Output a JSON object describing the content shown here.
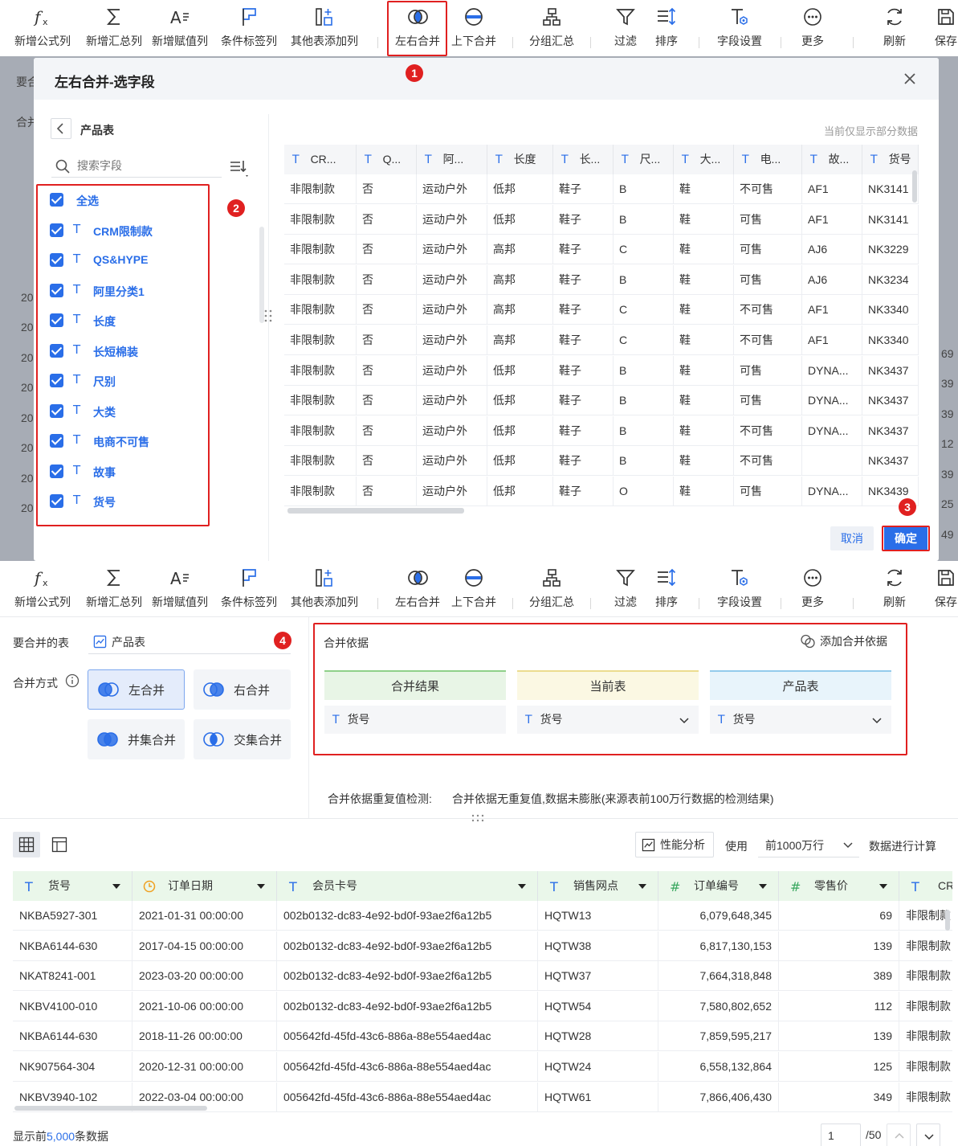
{
  "toolbar": {
    "items": [
      {
        "label": "新增公式列",
        "icon": "fx-icon"
      },
      {
        "label": "新增汇总列",
        "icon": "sigma-icon"
      },
      {
        "label": "新增赋值列",
        "icon": "assign-icon"
      },
      {
        "label": "条件标签列",
        "icon": "flag-icon"
      },
      {
        "label": "其他表添加列",
        "icon": "add-column-icon"
      },
      {
        "label": "左右合并",
        "icon": "left-right-merge-icon"
      },
      {
        "label": "上下合并",
        "icon": "top-bottom-merge-icon"
      },
      {
        "label": "分组汇总",
        "icon": "group-icon"
      },
      {
        "label": "过滤",
        "icon": "filter-icon"
      },
      {
        "label": "排序",
        "icon": "sort-icon"
      },
      {
        "label": "字段设置",
        "icon": "field-settings-icon"
      },
      {
        "label": "更多",
        "icon": "more-icon"
      },
      {
        "label": "刷新",
        "icon": "refresh-icon"
      },
      {
        "label": "保存",
        "icon": "save-icon"
      }
    ]
  },
  "background_fragments": {
    "row1": "要合",
    "row2": "合并",
    "left_values": [
      "20",
      "20",
      "20",
      "20",
      "20",
      "20",
      "20",
      "20"
    ],
    "right_values": [
      "69",
      "39",
      "39",
      "12",
      "39",
      "25",
      "49"
    ]
  },
  "modal": {
    "title": "左右合并-选字段",
    "back_label": "产品表",
    "search_placeholder": "搜索字段",
    "preview_note": "当前仅显示部分数据",
    "select_all": "全选",
    "fields": [
      "CRM限制款",
      "QS&HYPE",
      "阿里分类1",
      "长度",
      "长短棉装",
      "尺别",
      "大类",
      "电商不可售",
      "故事",
      "货号"
    ],
    "type_glyph": "T",
    "columns": [
      "CR...",
      "Q...",
      "阿...",
      "长度",
      "长...",
      "尺...",
      "大...",
      "电...",
      "故...",
      "货号"
    ],
    "rows": [
      [
        "非限制款",
        "否",
        "运动户外",
        "低邦",
        "鞋子",
        "B",
        "鞋",
        "不可售",
        "AF1",
        "NK3141"
      ],
      [
        "非限制款",
        "否",
        "运动户外",
        "低邦",
        "鞋子",
        "B",
        "鞋",
        "可售",
        "AF1",
        "NK3141"
      ],
      [
        "非限制款",
        "否",
        "运动户外",
        "高邦",
        "鞋子",
        "C",
        "鞋",
        "可售",
        "AJ6",
        "NK3229"
      ],
      [
        "非限制款",
        "否",
        "运动户外",
        "高邦",
        "鞋子",
        "B",
        "鞋",
        "可售",
        "AJ6",
        "NK3234"
      ],
      [
        "非限制款",
        "否",
        "运动户外",
        "高邦",
        "鞋子",
        "C",
        "鞋",
        "不可售",
        "AF1",
        "NK3340"
      ],
      [
        "非限制款",
        "否",
        "运动户外",
        "高邦",
        "鞋子",
        "C",
        "鞋",
        "不可售",
        "AF1",
        "NK3340"
      ],
      [
        "非限制款",
        "否",
        "运动户外",
        "低邦",
        "鞋子",
        "B",
        "鞋",
        "可售",
        "DYNA...",
        "NK3437"
      ],
      [
        "非限制款",
        "否",
        "运动户外",
        "低邦",
        "鞋子",
        "B",
        "鞋",
        "可售",
        "DYNA...",
        "NK3437"
      ],
      [
        "非限制款",
        "否",
        "运动户外",
        "低邦",
        "鞋子",
        "B",
        "鞋",
        "不可售",
        "DYNA...",
        "NK3437"
      ],
      [
        "非限制款",
        "否",
        "运动户外",
        "低邦",
        "鞋子",
        "B",
        "鞋",
        "不可售",
        "",
        "NK3437"
      ],
      [
        "非限制款",
        "否",
        "运动户外",
        "低邦",
        "鞋子",
        "O",
        "鞋",
        "可售",
        "DYNA...",
        "NK3439"
      ]
    ],
    "cancel_label": "取消",
    "confirm_label": "确定"
  },
  "badges": [
    "1",
    "2",
    "3",
    "4"
  ],
  "merge_config": {
    "table_label": "要合并的表",
    "table_value": "产品表",
    "method_label": "合并方式",
    "methods": [
      "左合并",
      "右合并",
      "并集合并",
      "交集合并"
    ],
    "basis_title": "合并依据",
    "add_basis": "添加合并依据",
    "basis_columns": [
      {
        "title": "合并结果",
        "field": "货号",
        "color": "#e8f5e6",
        "border": "#8fd08a"
      },
      {
        "title": "当前表",
        "field": "货号",
        "color": "#fbf8e3",
        "border": "#ecdc8f"
      },
      {
        "title": "产品表",
        "field": "货号",
        "color": "#e8f4fb",
        "border": "#94cbec"
      }
    ],
    "dup_check_label": "合并依据重复值检测:",
    "dup_check_result": "合并依据无重复值,数据未膨胀(来源表前100万行数据的检测结果)"
  },
  "result_table": {
    "perf_label": "性能分析",
    "use_label": "使用",
    "rows_option": "前1000万行",
    "calc_label": "数据进行计算",
    "columns": [
      {
        "name": "货号",
        "type": "text"
      },
      {
        "name": "订单日期",
        "type": "date"
      },
      {
        "name": "会员卡号",
        "type": "text"
      },
      {
        "name": "销售网点",
        "type": "text"
      },
      {
        "name": "订单编号",
        "type": "number"
      },
      {
        "name": "零售价",
        "type": "number"
      },
      {
        "name": "CR",
        "type": "text"
      }
    ],
    "rows": [
      [
        "NKBA5927-301",
        "2021-01-31 00:00:00",
        "002b0132-dc83-4e92-bd0f-93ae2f6a12b5",
        "HQTW13",
        "6,079,648,345",
        "69",
        "非限制款"
      ],
      [
        "NKBA6144-630",
        "2017-04-15 00:00:00",
        "002b0132-dc83-4e92-bd0f-93ae2f6a12b5",
        "HQTW38",
        "6,817,130,153",
        "139",
        "非限制款"
      ],
      [
        "NKAT8241-001",
        "2023-03-20 00:00:00",
        "002b0132-dc83-4e92-bd0f-93ae2f6a12b5",
        "HQTW37",
        "7,664,318,848",
        "389",
        "非限制款"
      ],
      [
        "NKBV4100-010",
        "2021-10-06 00:00:00",
        "002b0132-dc83-4e92-bd0f-93ae2f6a12b5",
        "HQTW54",
        "7,580,802,652",
        "112",
        "非限制款"
      ],
      [
        "NKBA6144-630",
        "2018-11-26 00:00:00",
        "005642fd-45fd-43c6-886a-88e554aed4ac",
        "HQTW28",
        "7,859,595,217",
        "139",
        "非限制款"
      ],
      [
        "NK907564-304",
        "2020-12-31 00:00:00",
        "005642fd-45fd-43c6-886a-88e554aed4ac",
        "HQTW24",
        "6,558,132,864",
        "125",
        "非限制款"
      ],
      [
        "NKBV3940-102",
        "2022-03-04 00:00:00",
        "005642fd-45fd-43c6-886a-88e554aed4ac",
        "HQTW61",
        "7,866,406,430",
        "349",
        "非限制款"
      ]
    ],
    "footer_prefix": "显示前",
    "footer_count": "5,000",
    "footer_suffix": "条数据",
    "page_value": "1",
    "page_total": "/50"
  },
  "colors": {
    "accent": "#2a6ee8",
    "red": "#e02020",
    "green_head": "#eaf7ea"
  }
}
